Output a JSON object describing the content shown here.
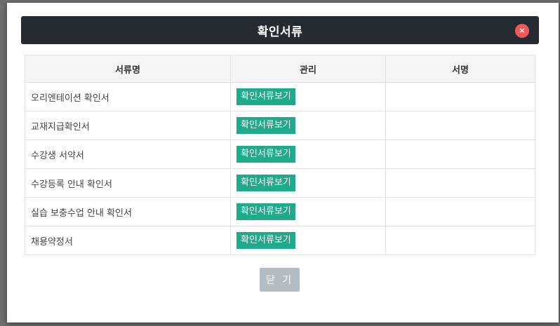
{
  "modal": {
    "title": "확인서류",
    "close_icon": "×",
    "close_button_label": "닫 기"
  },
  "table": {
    "headers": [
      "서류명",
      "관리",
      "서명"
    ],
    "rows": [
      {
        "name": "오리엔테이션 확인서",
        "action": "확인서류보기",
        "signature": ""
      },
      {
        "name": "교재지급확인서",
        "action": "확인서류보기",
        "signature": ""
      },
      {
        "name": "수강생 서약서",
        "action": "확인서류보기",
        "signature": ""
      },
      {
        "name": "수강등록 안내 확인서",
        "action": "확인서류보기",
        "signature": ""
      },
      {
        "name": "실습 보충수업 안내 확인서",
        "action": "확인서류보기",
        "signature": ""
      },
      {
        "name": "채용약정서",
        "action": "확인서류보기",
        "signature": ""
      }
    ]
  },
  "colors": {
    "header_bg": "#262a31",
    "close_red": "#f1585b",
    "action_green": "#1dab8a",
    "footer_button_gray": "#b4bcc4"
  }
}
